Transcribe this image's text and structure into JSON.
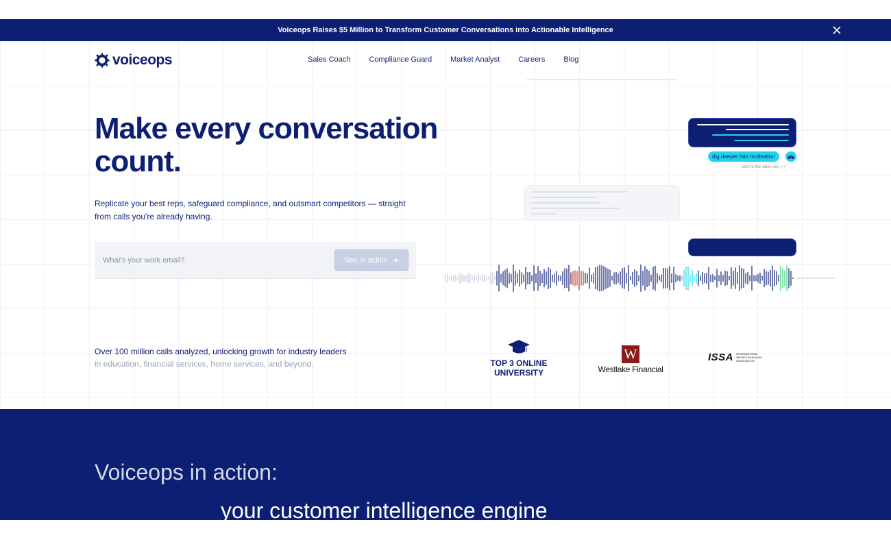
{
  "banner": {
    "text": "Voiceops Raises $5 Million to Transform Customer Conversations into Actionable Intelligence",
    "close_icon": "close-icon"
  },
  "nav": {
    "logo_text": "voiceops",
    "items": [
      "Sales Coach",
      "Compliance Guard",
      "Market Analyst",
      "Careers",
      "Blog"
    ]
  },
  "hero": {
    "title": "Make every conversation count.",
    "subtitle": "Replicate your best reps, safeguard compliance, and outsmart competitors — straight from calls you're already having.",
    "email_placeholder": "What's your work email?",
    "cta_label": "See in action",
    "cta_icon": "arrow-right-icon"
  },
  "visual": {
    "tag_label": "dig deeper into motivation",
    "tag_icon": "binoculars-icon",
    "sent_note": "sent to the sales rep"
  },
  "stats": {
    "line1": "Over 100 million calls analyzed, unlocking growth for industry leaders",
    "line2": "in education, financial services, home services, and beyond."
  },
  "customers": {
    "university": {
      "line1": "TOP 3 ONLINE",
      "line2": "UNIVERSITY",
      "icon": "graduation-cap-icon"
    },
    "westlake": {
      "mark": "W",
      "name": "Westlake Financial"
    },
    "issa": {
      "name": "ISSA",
      "sub": "INTERNATIONAL SPORTS SCIENCES ASSOCIATION"
    }
  },
  "section": {
    "title": "Voiceops in action:",
    "subtitle": "your customer intelligence engine"
  },
  "colors": {
    "brand": "#0d1f73",
    "accent": "#21d4e8",
    "wave_red": "#c0392b",
    "wave_green": "#2ecc71"
  }
}
